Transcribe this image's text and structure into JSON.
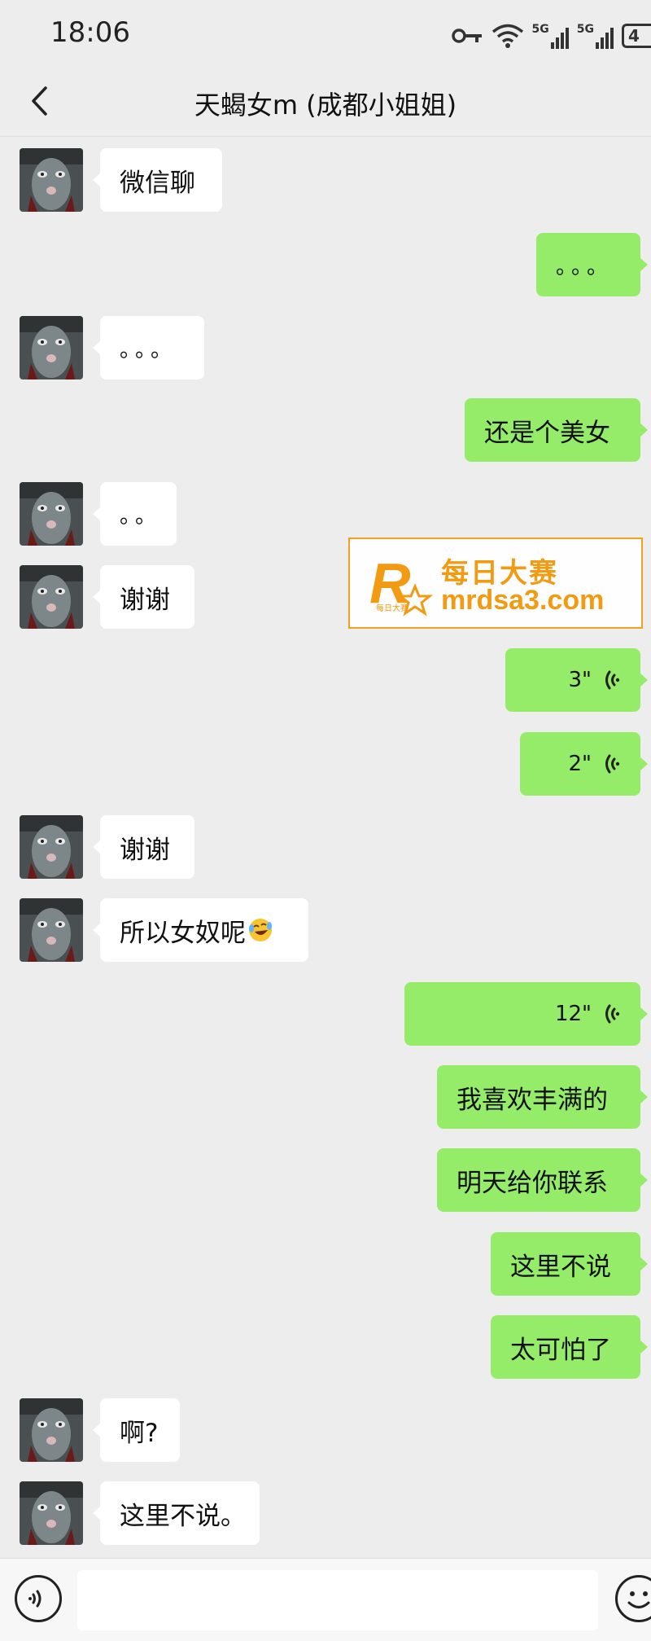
{
  "status_bar": {
    "time": "18:06",
    "network_1": "5G",
    "network_2": "5G",
    "battery": "4"
  },
  "nav": {
    "title": "天蝎女m (成都小姐姐)",
    "back_icon": "chevron-left-icon"
  },
  "messages": [
    {
      "side": "in",
      "type": "text",
      "text": "微信聊"
    },
    {
      "side": "out",
      "type": "text",
      "text": "。。。"
    },
    {
      "side": "in",
      "type": "text",
      "text": "。。。"
    },
    {
      "side": "out",
      "type": "text",
      "text": "还是个美女"
    },
    {
      "side": "in",
      "type": "text",
      "text": "。。"
    },
    {
      "side": "in",
      "type": "text",
      "text": "谢谢"
    },
    {
      "side": "out",
      "type": "voice",
      "duration": "3\""
    },
    {
      "side": "out",
      "type": "voice",
      "duration": "2\""
    },
    {
      "side": "in",
      "type": "text",
      "text": "谢谢"
    },
    {
      "side": "in",
      "type": "text",
      "text": "所以女奴呢",
      "emoji": "laughing-crying-face"
    },
    {
      "side": "out",
      "type": "voice",
      "duration": "12\""
    },
    {
      "side": "out",
      "type": "text",
      "text": "我喜欢丰满的"
    },
    {
      "side": "out",
      "type": "text",
      "text": "明天给你联系"
    },
    {
      "side": "out",
      "type": "text",
      "text": "这里不说"
    },
    {
      "side": "out",
      "type": "text",
      "text": "太可怕了"
    },
    {
      "side": "in",
      "type": "text",
      "text": "啊?"
    },
    {
      "side": "in",
      "type": "text",
      "text": "这里不说。"
    }
  ],
  "watermark": {
    "name": "每日大赛",
    "domain": "mrdsa3.com",
    "logo_letter": "R",
    "logo_small": "每日大赛"
  },
  "input_bar": {
    "value": "",
    "voice_icon": "voice-input-icon",
    "emoji_icon": "emoji-icon"
  },
  "colors": {
    "background": "#ededed",
    "incoming_bubble": "#ffffff",
    "outgoing_bubble": "#95ec69",
    "watermark": "#f29b12"
  }
}
